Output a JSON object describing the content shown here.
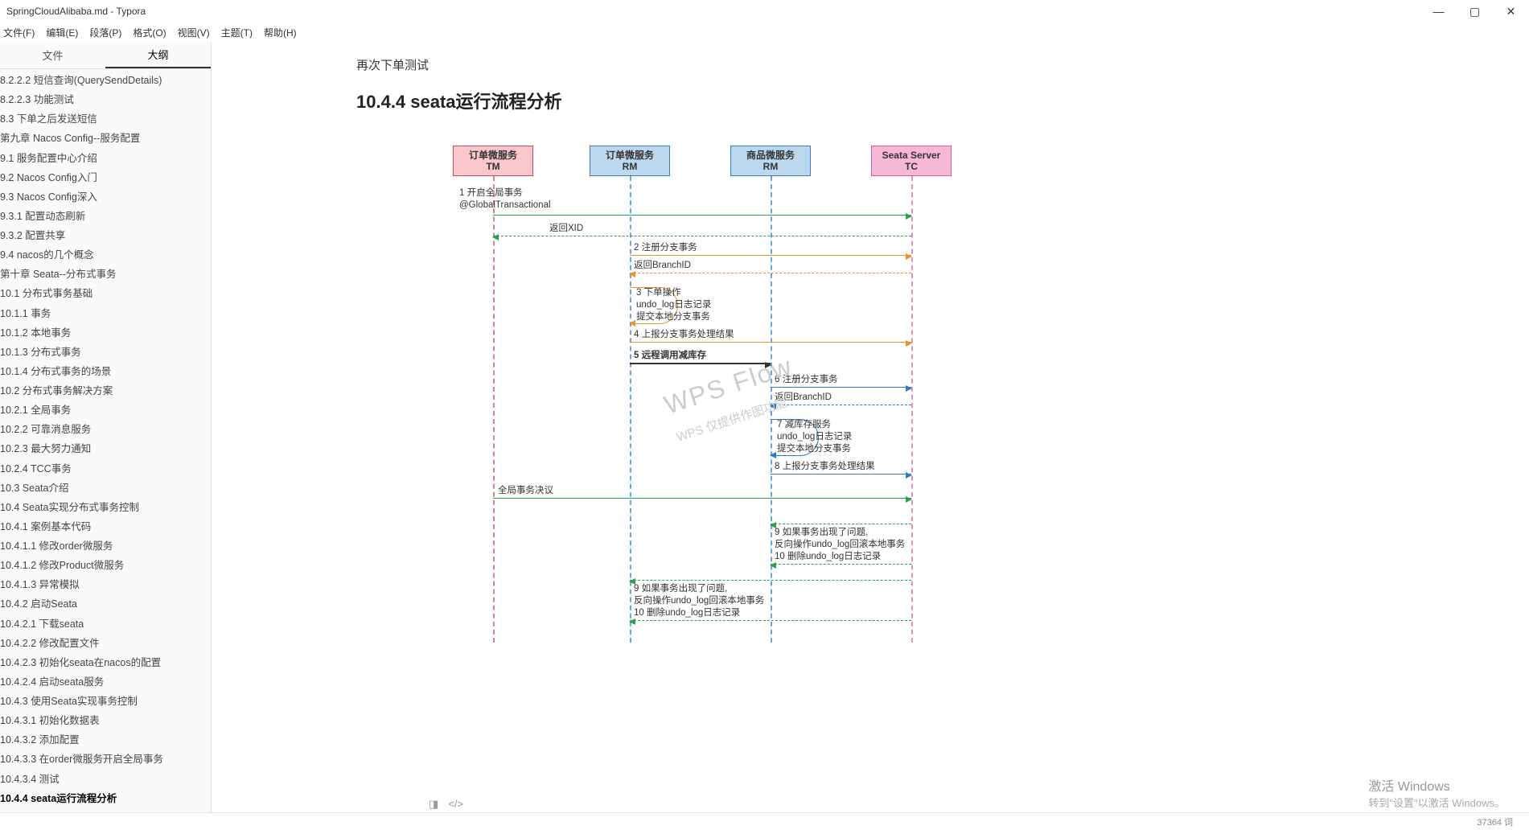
{
  "window": {
    "title": "SpringCloudAlibaba.md - Typora"
  },
  "menu": {
    "file": "文件(F)",
    "edit": "编辑(E)",
    "para": "段落(P)",
    "format": "格式(O)",
    "view": "视图(V)",
    "theme": "主题(T)",
    "help": "帮助(H)"
  },
  "side_tabs": {
    "files": "文件",
    "outline": "大纲"
  },
  "outline": [
    {
      "t": "8.2.2.2 短信查询(QuerySendDetails)",
      "lvl": 4
    },
    {
      "t": "8.2.2.3 功能测试",
      "lvl": 4
    },
    {
      "t": "8.3 下单之后发送短信",
      "lvl": 2
    },
    {
      "t": "第九章 Nacos Config--服务配置",
      "lvl": 1
    },
    {
      "t": "9.1 服务配置中心介绍",
      "lvl": 2
    },
    {
      "t": "9.2 Nacos Config入门",
      "lvl": 2
    },
    {
      "t": "9.3 Nacos Config深入",
      "lvl": 2
    },
    {
      "t": "9.3.1 配置动态刷新",
      "lvl": 3
    },
    {
      "t": "9.3.2 配置共享",
      "lvl": 3
    },
    {
      "t": "9.4 nacos的几个概念",
      "lvl": 2
    },
    {
      "t": "第十章 Seata--分布式事务",
      "lvl": 1
    },
    {
      "t": "10.1 分布式事务基础",
      "lvl": 2
    },
    {
      "t": "10.1.1 事务",
      "lvl": 3
    },
    {
      "t": "10.1.2 本地事务",
      "lvl": 3
    },
    {
      "t": "10.1.3 分布式事务",
      "lvl": 3
    },
    {
      "t": "10.1.4 分布式事务的场景",
      "lvl": 3
    },
    {
      "t": "10.2 分布式事务解决方案",
      "lvl": 2
    },
    {
      "t": "10.2.1 全局事务",
      "lvl": 3
    },
    {
      "t": "10.2.2 可靠消息服务",
      "lvl": 3
    },
    {
      "t": "10.2.3 最大努力通知",
      "lvl": 3
    },
    {
      "t": "10.2.4 TCC事务",
      "lvl": 3
    },
    {
      "t": "10.3 Seata介绍",
      "lvl": 2
    },
    {
      "t": "10.4 Seata实现分布式事务控制",
      "lvl": 2
    },
    {
      "t": "10.4.1 案例基本代码",
      "lvl": 3
    },
    {
      "t": "10.4.1.1 修改order微服务",
      "lvl": 4
    },
    {
      "t": "10.4.1.2 修改Product微服务",
      "lvl": 4
    },
    {
      "t": "10.4.1.3 异常模拟",
      "lvl": 4
    },
    {
      "t": "10.4.2 启动Seata",
      "lvl": 3
    },
    {
      "t": "10.4.2.1 下载seata",
      "lvl": 4
    },
    {
      "t": "10.4.2.2 修改配置文件",
      "lvl": 4
    },
    {
      "t": "10.4.2.3 初始化seata在nacos的配置",
      "lvl": 4
    },
    {
      "t": "10.4.2.4 启动seata服务",
      "lvl": 4
    },
    {
      "t": "10.4.3 使用Seata实现事务控制",
      "lvl": 3
    },
    {
      "t": "10.4.3.1 初始化数据表",
      "lvl": 4
    },
    {
      "t": "10.4.3.2 添加配置",
      "lvl": 4
    },
    {
      "t": "10.4.3.3 在order微服务开启全局事务",
      "lvl": 4
    },
    {
      "t": "10.4.3.4 测试",
      "lvl": 4
    },
    {
      "t": "10.4.4 seata运行流程分析",
      "lvl": 3,
      "bold": true
    }
  ],
  "doc": {
    "para": "再次下单测试",
    "heading": "10.4.4 seata运行流程分析"
  },
  "actors": {
    "a1l1": "订单微服务",
    "a1l2": "TM",
    "a2l1": "订单微服务",
    "a2l2": "RM",
    "a3l1": "商品微服务",
    "a3l2": "RM",
    "a4l1": "Seata Server",
    "a4l2": "TC"
  },
  "msgs": {
    "m1a": "1 开启全局事务",
    "m1b": "@GlobalTransactional",
    "m2": "返回XID",
    "m3": "2 注册分支事务",
    "m4": "返回BranchID",
    "m5a": "3  下单操作",
    "m5b": "    undo_log日志记录",
    "m5c": "    提交本地分支事务",
    "m6": "4 上报分支事务处理结果",
    "m7": "5 远程调用减库存",
    "m8": "6 注册分支事务",
    "m9": "返回BranchID",
    "m10a": "7  减库存服务",
    "m10b": "    undo_log日志记录",
    "m10c": "    提交本地分支事务",
    "m11": "8 上报分支事务处理结果",
    "m12": "全局事务决议",
    "m13a": "9    如果事务出现了问题,",
    "m13b": "      反向操作undo_log回滚本地事务",
    "m13c": "10  删除undo_log日志记录",
    "m14a": "9    如果事务出现了问题,",
    "m14b": "      反向操作undo_log回滚本地事务",
    "m14c": "10  删除undo_log日志记录"
  },
  "watermark": {
    "w1": "WPS Flow",
    "w2": "WPS 仅提供作图功能"
  },
  "footer": {
    "t": "激活 Windows",
    "s": "转到\"设置\"以激活 Windows。"
  },
  "status": {
    "words": "37364 词"
  }
}
